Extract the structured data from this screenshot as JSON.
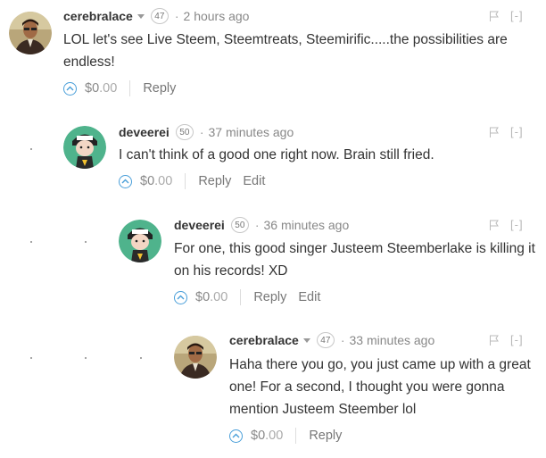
{
  "comments": [
    {
      "author": "cerebralace",
      "reputation": "47",
      "time": "2 hours ago",
      "body": "LOL let's see Live Steem, Steemtreats, Steemirific.....the possibilities are endless!",
      "payout_main": "$0",
      "payout_cents": ".00",
      "actions": [
        "Reply"
      ],
      "collapse": "[-]",
      "avatar": "cerebralace-avatar"
    },
    {
      "author": "deveerei",
      "reputation": "50",
      "time": "37 minutes ago",
      "body": "I can't think of a good one right now. Brain still fried.",
      "payout_main": "$0",
      "payout_cents": ".00",
      "actions": [
        "Reply",
        "Edit"
      ],
      "collapse": "[-]",
      "avatar": "deveerei-avatar"
    },
    {
      "author": "deveerei",
      "reputation": "50",
      "time": "36 minutes ago",
      "body": "For one, this good singer Justeem Steemberlake is killing it on his records! XD",
      "payout_main": "$0",
      "payout_cents": ".00",
      "actions": [
        "Reply",
        "Edit"
      ],
      "collapse": "[-]",
      "avatar": "deveerei-avatar"
    },
    {
      "author": "cerebralace",
      "reputation": "47",
      "time": "33 minutes ago",
      "body": "Haha there you go, you just came up with a great one! For a second, I thought you were gonna mention Justeem Steember lol",
      "payout_main": "$0",
      "payout_cents": ".00",
      "actions": [
        "Reply"
      ],
      "collapse": "[-]",
      "avatar": "cerebralace-avatar"
    }
  ],
  "colors": {
    "vote": "#4a9fd9",
    "text": "#333333",
    "muted": "#888888"
  },
  "icons": {
    "vote": "upvote-chevron-icon",
    "flag": "flag-icon",
    "menu": "chevron-down-icon"
  }
}
